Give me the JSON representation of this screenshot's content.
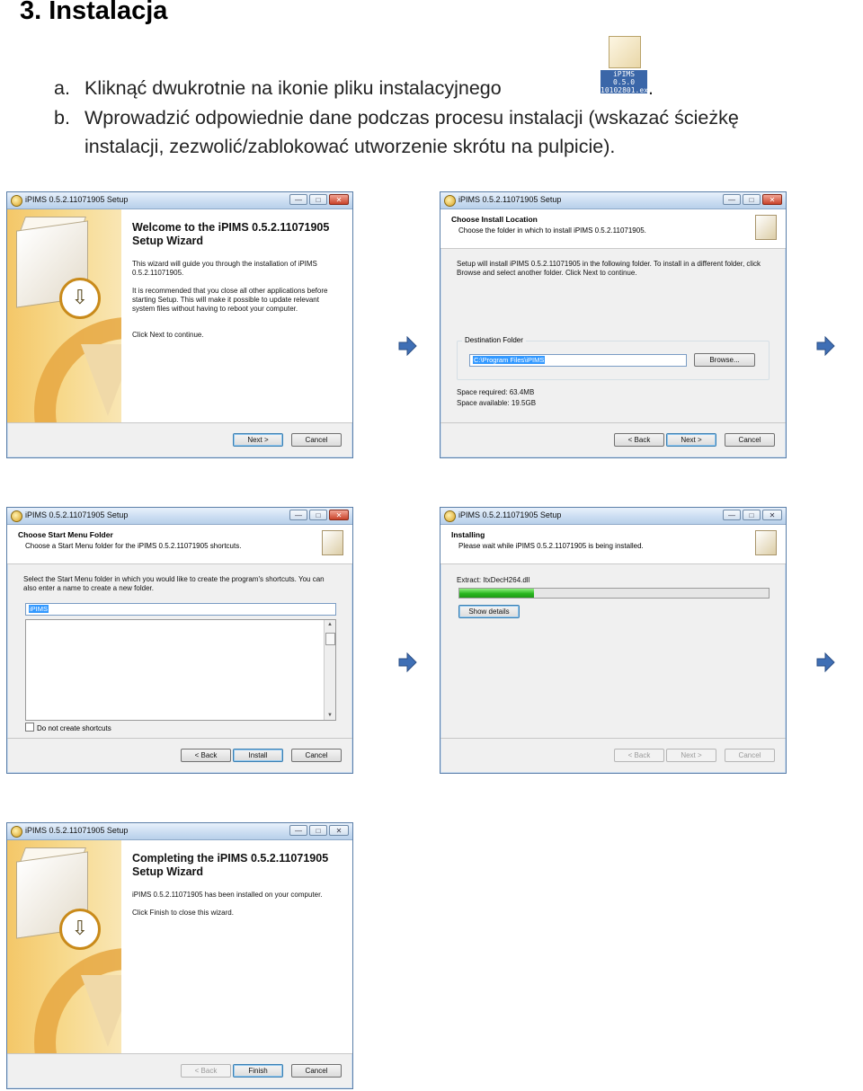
{
  "heading": "3. Instalacja",
  "steps": [
    {
      "marker": "a.",
      "text": "Kliknąć dwukrotnie na ikonie pliku instalacyjnego",
      "suffix": "."
    },
    {
      "marker": "b.",
      "text": "Wprowadzić odpowiednie dane podczas procesu instalacji (wskazać ścieżkę",
      "continuation": "instalacji, zezwolić/zablokować utworzenie skrótu na pulpicie)."
    }
  ],
  "file_icon": {
    "name": "installer-file-icon",
    "caption": "iPIMS 0.5.0 10102801.ex e"
  },
  "arrow_icon": "right-arrow-icon",
  "windows": {
    "welcome": {
      "title": "iPIMS 0.5.2.11071905 Setup",
      "heading": "Welcome to the iPIMS 0.5.2.11071905 Setup Wizard",
      "p1": "This wizard will guide you through the installation of iPIMS 0.5.2.11071905.",
      "p2": "It is recommended that you close all other applications before starting Setup. This will make it possible to update relevant system files without having to reboot your computer.",
      "p3": "Click Next to continue.",
      "next": "Next >",
      "cancel": "Cancel"
    },
    "location": {
      "title": "iPIMS 0.5.2.11071905 Setup",
      "header_title": "Choose Install Location",
      "header_sub": "Choose the folder in which to install iPIMS 0.5.2.11071905.",
      "body": "Setup will install iPIMS 0.5.2.11071905 in the following folder. To install in a different folder, click Browse and select another folder. Click Next to continue.",
      "group_label": "Destination Folder",
      "path": "C:\\Program Files\\iPIMS",
      "browse": "Browse...",
      "space_required": "Space required: 63.4MB",
      "space_available": "Space available: 19.5GB",
      "back": "< Back",
      "next": "Next >",
      "cancel": "Cancel"
    },
    "startmenu": {
      "title": "iPIMS 0.5.2.11071905 Setup",
      "header_title": "Choose Start Menu Folder",
      "header_sub": "Choose a Start Menu folder for the iPIMS 0.5.2.11071905 shortcuts.",
      "body": "Select the Start Menu folder in which you would like to create the program's shortcuts. You can also enter a name to create a new folder.",
      "folder": "iPIMS",
      "no_shortcuts": "Do not create shortcuts",
      "back": "< Back",
      "install": "Install",
      "cancel": "Cancel"
    },
    "installing": {
      "title": "iPIMS 0.5.2.11071905 Setup",
      "header_title": "Installing",
      "header_sub": "Please wait while iPIMS 0.5.2.11071905 is being installed.",
      "extract": "Extract: ItxDecH264.dll",
      "progress": 0.24,
      "show_details": "Show details",
      "back": "< Back",
      "next": "Next >",
      "cancel": "Cancel"
    },
    "complete": {
      "title": "iPIMS 0.5.2.11071905 Setup",
      "heading": "Completing the iPIMS 0.5.2.11071905 Setup Wizard",
      "p1": "iPIMS 0.5.2.11071905 has been installed on your computer.",
      "p2": "Click Finish to close this wizard.",
      "back": "< Back",
      "finish": "Finish",
      "cancel": "Cancel"
    }
  }
}
